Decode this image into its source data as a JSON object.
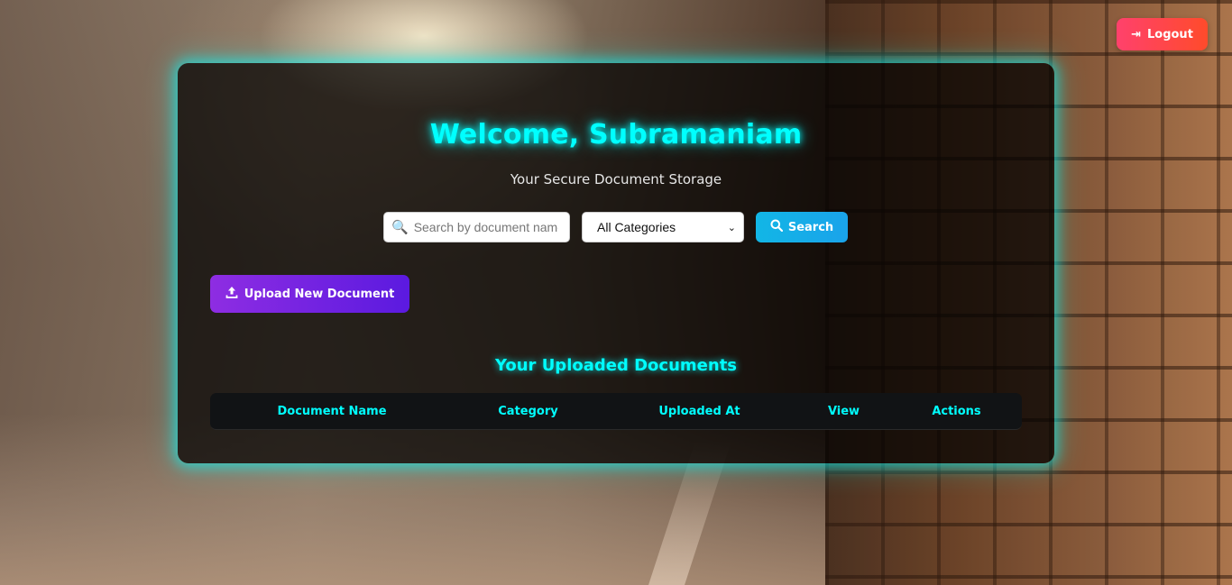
{
  "header": {
    "logout_label": "Logout",
    "logout_icon": "logout-icon"
  },
  "panel": {
    "welcome": "Welcome, Subramaniam",
    "subtitle": "Your Secure Document Storage"
  },
  "search": {
    "placeholder": "Search by document name",
    "value": "",
    "icon": "magnifier-icon",
    "category_selected": "All Categories",
    "button_label": "Search"
  },
  "upload": {
    "button_label": "Upload New Document",
    "icon": "upload-icon"
  },
  "documents": {
    "heading": "Your Uploaded Documents",
    "columns": [
      "Document Name",
      "Category",
      "Uploaded At",
      "View",
      "Actions"
    ],
    "rows": []
  },
  "colors": {
    "accent_cyan": "#00ffff",
    "logout_red": "#ff4b2b",
    "search_blue": "#12b6e6",
    "upload_purple": "#8e2de2"
  }
}
